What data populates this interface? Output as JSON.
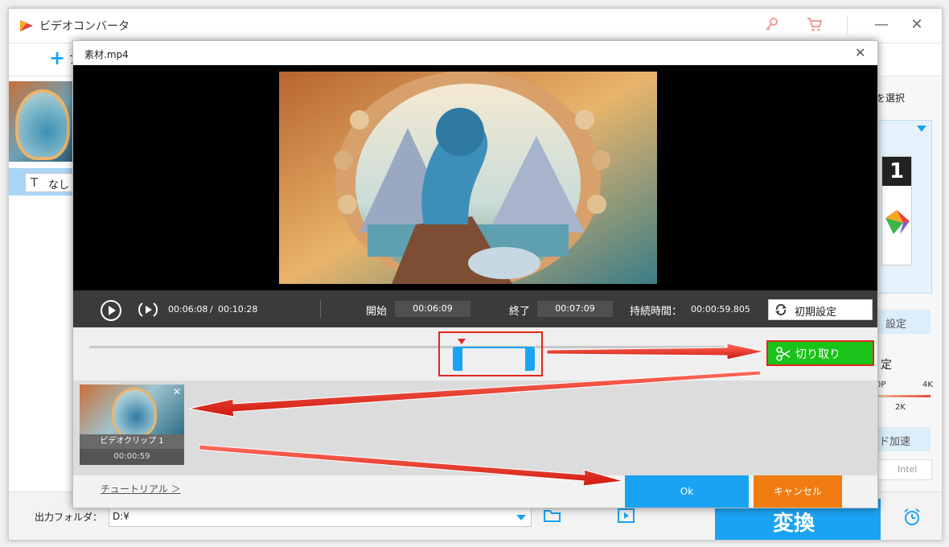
{
  "app": {
    "title": "ビデオコンバータ",
    "accent": "#1aa3f2",
    "win_minimize": "—",
    "win_maximize": "☐",
    "win_close": "✕"
  },
  "toolbar": {
    "add_label_fragment": "フ"
  },
  "left_panel": {
    "subtitle_none": "なし"
  },
  "right_panel": {
    "select_fragment": "を選択",
    "format_card_text": "1",
    "settings_fragment": "設定",
    "settings2_fragment": "定",
    "quality_low": "0P",
    "quality_high": "4K",
    "quality_mid": "2K",
    "hw_accel_fragment": "ド加速",
    "intel_label": "Intel"
  },
  "bottom": {
    "output_label": "出力フォルダ：",
    "output_path": "D:¥",
    "convert_label": "変換"
  },
  "dialog": {
    "title": "素材.mp4",
    "close": "✕",
    "controls": {
      "current_time": "00:06:08",
      "separator": "/",
      "total_time": "00:10:28",
      "start_label": "開始",
      "start_value": "00:06:09",
      "end_label": "終了",
      "end_value": "00:07:09",
      "duration_label": "持続時間：",
      "duration_value": "00:00:59.805",
      "reset_label": "初期設定"
    },
    "cut_label": "切り取り",
    "clip": {
      "name": "ビデオクリップ 1",
      "duration": "00:00:59"
    },
    "tutorial_label": "チュートリアル ＞",
    "ok_label": "Ok",
    "cancel_label": "キャンセル"
  },
  "colors": {
    "cut_green": "#19c319",
    "cancel_orange": "#f07c12",
    "ok_blue": "#1aa3f2",
    "annotation_red": "#e3261b"
  }
}
